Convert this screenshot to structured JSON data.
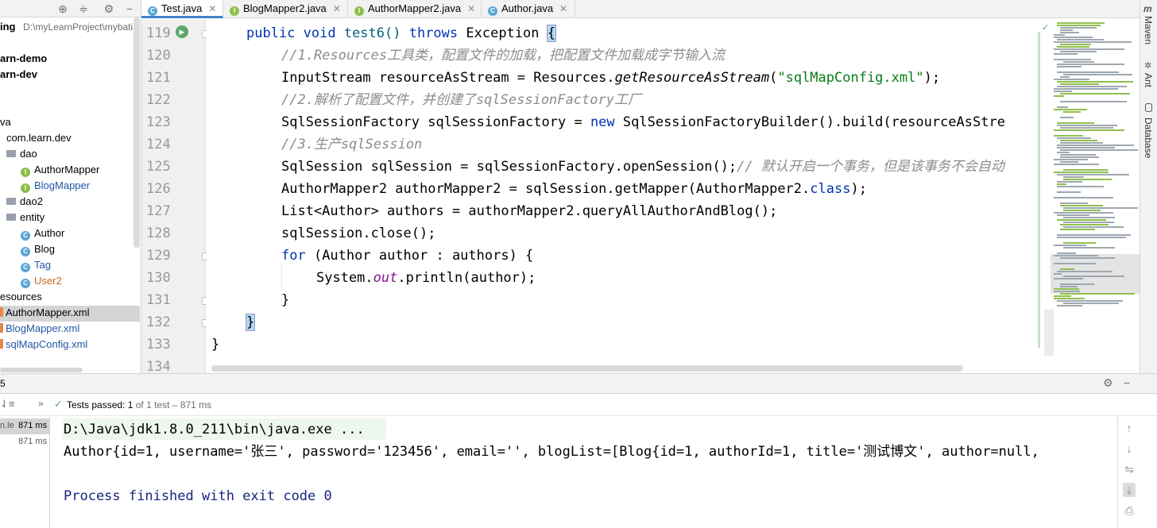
{
  "project": {
    "path_bold": "ing",
    "path_text": "D:\\myLearnProject\\mybati",
    "items": [
      {
        "label": "arn-demo"
      },
      {
        "label": "arn-dev"
      },
      {
        "label": "va"
      },
      {
        "label": "com.learn.dev"
      },
      {
        "label": "dao"
      },
      {
        "label": "AuthorMapper"
      },
      {
        "label": "BlogMapper"
      },
      {
        "label": "dao2"
      },
      {
        "label": "entity"
      },
      {
        "label": "Author"
      },
      {
        "label": "Blog"
      },
      {
        "label": "Tag"
      },
      {
        "label": "User2"
      },
      {
        "label": "esources"
      },
      {
        "label": "AuthorMapper.xml"
      },
      {
        "label": "BlogMapper.xml"
      },
      {
        "label": "sqlMapConfig.xml"
      }
    ]
  },
  "tabs": [
    {
      "label": "Test.java",
      "icon": "class-icon",
      "active": true
    },
    {
      "label": "BlogMapper2.java",
      "icon": "interface-icon"
    },
    {
      "label": "AuthorMapper2.java",
      "icon": "interface-icon"
    },
    {
      "label": "Author.java",
      "icon": "class-icon"
    }
  ],
  "editor": {
    "line_numbers": [
      "119",
      "120",
      "121",
      "122",
      "123",
      "124",
      "125",
      "126",
      "127",
      "128",
      "129",
      "130",
      "131",
      "132",
      "133",
      "134"
    ],
    "lines": {
      "l119_kw1": "public void ",
      "l119_name": "test6() ",
      "l119_kw2": "throws ",
      "l119_rest": "Exception ",
      "l119_brace": "{",
      "l120": "//1.Resources工具类，配置文件的加载，把配置文件加载成字节输入流",
      "l121_a": "InputStream resourceAsStream = Resources.",
      "l121_m": "getResourceAsStream",
      "l121_b": "(",
      "l121_s": "\"sqlMapConfig.xml\"",
      "l121_c": ");",
      "l122": "//2.解析了配置文件，并创建了sqlSessionFactory工厂",
      "l123_a": "SqlSessionFactory sqlSessionFactory = ",
      "l123_kw": "new ",
      "l123_b": "SqlSessionFactoryBuilder().build(resourceAsStre",
      "l124": "//3.生产sqlSession",
      "l125_a": "SqlSession sqlSession = sqlSessionFactory.openSession();",
      "l125_c": "// 默认开启一个事务，但是该事务不会自动",
      "l126_a": "AuthorMapper2 authorMapper2 = sqlSession.getMapper(AuthorMapper2.",
      "l126_kw": "class",
      "l126_b": ");",
      "l127": "List<Author> authors = authorMapper2.queryAllAuthorAndBlog();",
      "l128": "sqlSession.close();",
      "l129_kw": "for ",
      "l129_b": "(Author author : authors) {",
      "l130_a": "System.",
      "l130_f": "out",
      "l130_b": ".println(author);",
      "l131": "}",
      "l132": "}",
      "l133": "}"
    }
  },
  "right_bar": {
    "maven": "Maven",
    "ant": "Ant",
    "database": "Database"
  },
  "run_panel": {
    "tab_label": "5",
    "tests_passed_label": "Tests passed:",
    "tests_passed_count": "1",
    "tests_passed_rest": "of 1 test – 871 ms",
    "left_items": [
      {
        "label": "n.le",
        "time": "871 ms"
      },
      {
        "label": "",
        "time": "871 ms"
      }
    ],
    "console": {
      "cmd": "D:\\Java\\jdk1.8.0_211\\bin\\java.exe ...",
      "output": "Author{id=1, username='张三', password='123456', email='', blogList=[Blog{id=1, authorId=1, title='测试博文', author=null,",
      "exit": "Process finished with exit code 0"
    }
  },
  "colors": {
    "keyword": "#0033b3",
    "comment": "#8c8c8c",
    "string": "#067d17",
    "accent": "#4083c9"
  }
}
